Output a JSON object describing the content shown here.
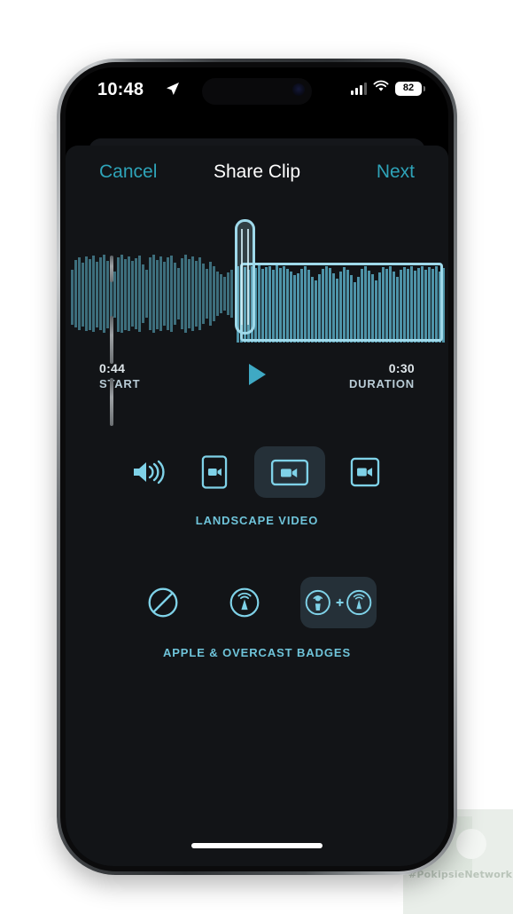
{
  "statusbar": {
    "time": "10:48",
    "location_icon": "location-arrow-icon",
    "cellular_icon": "signal-bars-icon",
    "wifi_icon": "wifi-icon",
    "battery_level": "82"
  },
  "navbar": {
    "cancel_label": "Cancel",
    "title": "Share Clip",
    "next_label": "Next"
  },
  "timeline": {
    "start_value": "0:44",
    "start_label": "START",
    "duration_value": "0:30",
    "duration_label": "DURATION",
    "play_icon": "play-icon"
  },
  "format_group": {
    "label": "LANDSCAPE VIDEO",
    "options": [
      {
        "icon": "audio-only-speaker-icon",
        "selected": false
      },
      {
        "icon": "portrait-video-icon",
        "selected": false
      },
      {
        "icon": "landscape-video-icon",
        "selected": true
      },
      {
        "icon": "square-video-icon",
        "selected": false
      }
    ]
  },
  "badges_group": {
    "label": "APPLE & OVERCAST BADGES",
    "options": [
      {
        "icon": "no-badge-slash-icon",
        "selected": false
      },
      {
        "icon": "overcast-antenna-icon",
        "selected": false
      },
      {
        "icon": "apple-plus-overcast-icon",
        "selected": true
      }
    ]
  },
  "colors": {
    "accent": "#2ea3b8",
    "icon_blue": "#7fd2e8",
    "selection_border": "#9fd9ea",
    "wave_inactive": "#3d6e7c",
    "wave_active": "#4e93a8",
    "sheet_bg": "#121417",
    "selected_chip_bg": "#253038"
  },
  "watermark": {
    "text": "#PokipsieNetwork"
  },
  "home_indicator": "home-indicator"
}
